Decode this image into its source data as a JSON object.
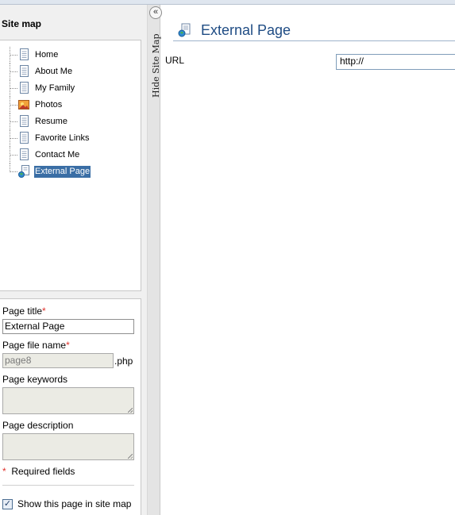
{
  "sitemap": {
    "title": "Site map",
    "items": [
      {
        "label": "Home",
        "icon": "page-icon"
      },
      {
        "label": "About Me",
        "icon": "page-icon"
      },
      {
        "label": "My Family",
        "icon": "page-icon"
      },
      {
        "label": "Photos",
        "icon": "photo-icon"
      },
      {
        "label": "Resume",
        "icon": "page-icon"
      },
      {
        "label": "Favorite Links",
        "icon": "page-icon"
      },
      {
        "label": "Contact Me",
        "icon": "page-icon"
      },
      {
        "label": "External Page",
        "icon": "external-page-icon",
        "selected": true
      }
    ]
  },
  "properties": {
    "page_title_label": "Page title",
    "page_title_value": "External Page",
    "file_name_label": "Page file name",
    "file_name_value": "page8",
    "file_ext": ".php",
    "keywords_label": "Page keywords",
    "description_label": "Page description",
    "required_marker": "*",
    "required_note": "Required fields",
    "show_in_sitemap_label": "Show this page in site map",
    "show_in_sitemap_checked": true
  },
  "splitter": {
    "hide_label": "Hide Site Map",
    "collapse_glyph": "«"
  },
  "main": {
    "title": "External Page",
    "url_label": "URL",
    "url_value": "http://"
  },
  "colors": {
    "selection": "#3a6ea5",
    "title": "#1f4c84",
    "required": "#e0312b"
  }
}
